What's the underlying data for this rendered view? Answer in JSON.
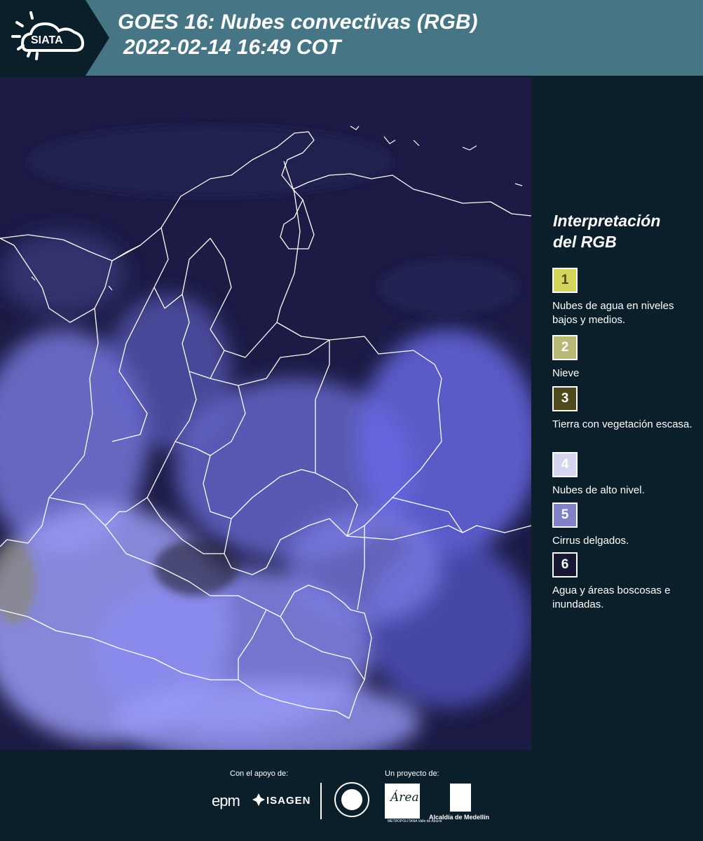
{
  "header": {
    "logo_text": "SIATA",
    "title_line1": "GOES 16: Nubes convectivas (RGB)",
    "title_line2": "2022-02-14 16:49 COT"
  },
  "legend": {
    "title_line1": "Interpretación",
    "title_line2": "del RGB",
    "items": [
      {
        "number": "1",
        "label": "Nubes de agua en niveles bajos y medios.",
        "color": "#d5d55b",
        "text_color": "#4a4a1a"
      },
      {
        "number": "2",
        "label": "Nieve",
        "color": "#b9b976",
        "text_color": "#ffffff"
      },
      {
        "number": "3",
        "label": "Tierra con vegetación escasa.",
        "color": "#4d4b1d",
        "text_color": "#ffffff"
      },
      {
        "number": "4",
        "label": "Nubes de alto nivel.",
        "color": "#d5d5f2",
        "text_color": "#ffffff"
      },
      {
        "number": "5",
        "label": "Cirrus delgados.",
        "color": "#8181c8",
        "text_color": "#ffffff"
      },
      {
        "number": "6",
        "label": "Agua y áreas boscosas e inundadas.",
        "color": "#171734",
        "text_color": "#ffffff"
      }
    ]
  },
  "footer": {
    "support_label": "Con el apoyo de:",
    "project_label": "Un proyecto de:",
    "sponsors": [
      "epm",
      "ISAGEN"
    ],
    "partners": [
      "Alcaldía de Medellín"
    ],
    "area_logo_text": "Área",
    "area_logo_sub": "METROPOLITANA Valle de Aburrá"
  },
  "map": {
    "background_color": "#1a1a42",
    "cloud_color": "#8f8fff",
    "border_color": "#ffffff"
  }
}
